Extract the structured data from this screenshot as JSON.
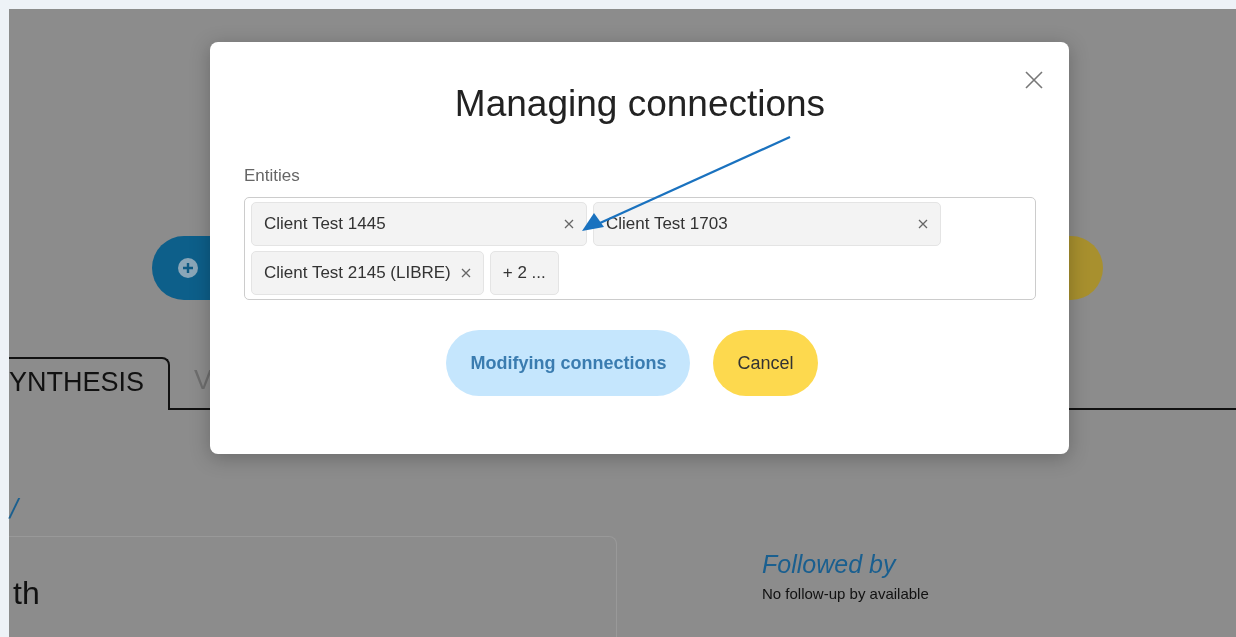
{
  "page": {
    "tabs": [
      {
        "label": "YNTHESIS",
        "selected": true
      },
      {
        "label": "V",
        "selected": false
      }
    ],
    "section_mark": "/",
    "card_text": "th",
    "followed_by": {
      "title": "Followed by",
      "text": "No follow-up by available"
    }
  },
  "dialog": {
    "title": "Managing connections",
    "field_label": "Entities",
    "chips": [
      {
        "label": "Client Test 1445",
        "kind": "entity"
      },
      {
        "label": "Client Test 1703",
        "kind": "entity"
      },
      {
        "label": "Client Test 2145 (LIBRE)",
        "kind": "entity"
      },
      {
        "label": "+ 2 ...",
        "kind": "more"
      }
    ],
    "buttons": [
      {
        "label": "Modifying connections",
        "kind": "primary",
        "disabled": true
      },
      {
        "label": "Cancel",
        "kind": "secondary",
        "disabled": false
      }
    ]
  }
}
